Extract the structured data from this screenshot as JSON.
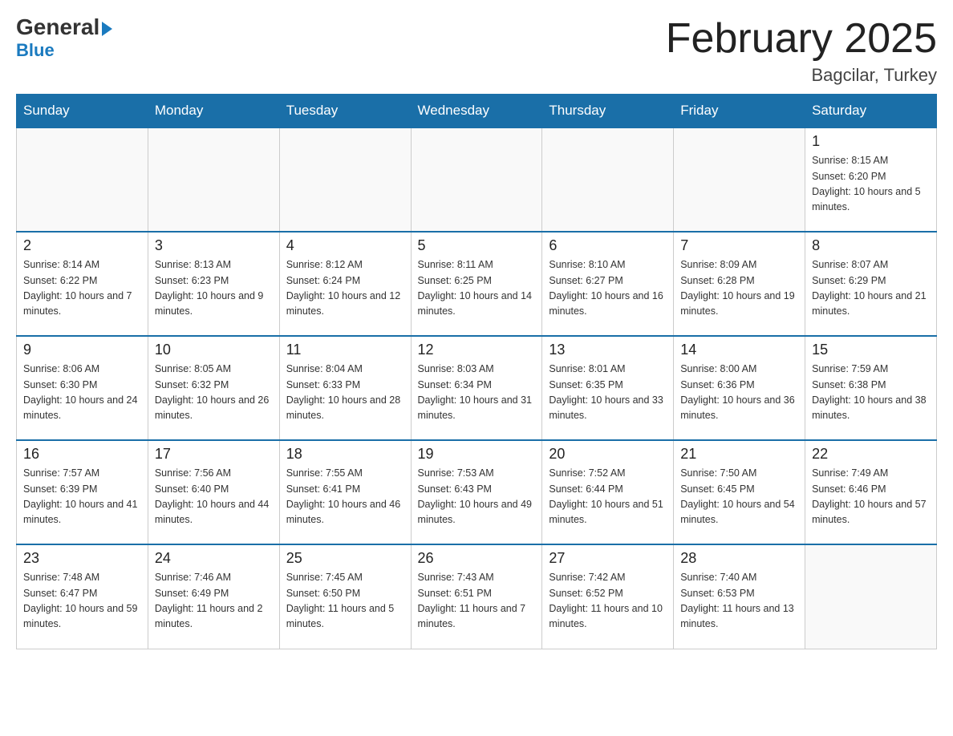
{
  "header": {
    "logo_general": "General",
    "logo_blue": "Blue",
    "month_title": "February 2025",
    "location": "Bagcilar, Turkey"
  },
  "days_of_week": [
    "Sunday",
    "Monday",
    "Tuesday",
    "Wednesday",
    "Thursday",
    "Friday",
    "Saturday"
  ],
  "weeks": [
    [
      {
        "day": "",
        "info": ""
      },
      {
        "day": "",
        "info": ""
      },
      {
        "day": "",
        "info": ""
      },
      {
        "day": "",
        "info": ""
      },
      {
        "day": "",
        "info": ""
      },
      {
        "day": "",
        "info": ""
      },
      {
        "day": "1",
        "info": "Sunrise: 8:15 AM\nSunset: 6:20 PM\nDaylight: 10 hours and 5 minutes."
      }
    ],
    [
      {
        "day": "2",
        "info": "Sunrise: 8:14 AM\nSunset: 6:22 PM\nDaylight: 10 hours and 7 minutes."
      },
      {
        "day": "3",
        "info": "Sunrise: 8:13 AM\nSunset: 6:23 PM\nDaylight: 10 hours and 9 minutes."
      },
      {
        "day": "4",
        "info": "Sunrise: 8:12 AM\nSunset: 6:24 PM\nDaylight: 10 hours and 12 minutes."
      },
      {
        "day": "5",
        "info": "Sunrise: 8:11 AM\nSunset: 6:25 PM\nDaylight: 10 hours and 14 minutes."
      },
      {
        "day": "6",
        "info": "Sunrise: 8:10 AM\nSunset: 6:27 PM\nDaylight: 10 hours and 16 minutes."
      },
      {
        "day": "7",
        "info": "Sunrise: 8:09 AM\nSunset: 6:28 PM\nDaylight: 10 hours and 19 minutes."
      },
      {
        "day": "8",
        "info": "Sunrise: 8:07 AM\nSunset: 6:29 PM\nDaylight: 10 hours and 21 minutes."
      }
    ],
    [
      {
        "day": "9",
        "info": "Sunrise: 8:06 AM\nSunset: 6:30 PM\nDaylight: 10 hours and 24 minutes."
      },
      {
        "day": "10",
        "info": "Sunrise: 8:05 AM\nSunset: 6:32 PM\nDaylight: 10 hours and 26 minutes."
      },
      {
        "day": "11",
        "info": "Sunrise: 8:04 AM\nSunset: 6:33 PM\nDaylight: 10 hours and 28 minutes."
      },
      {
        "day": "12",
        "info": "Sunrise: 8:03 AM\nSunset: 6:34 PM\nDaylight: 10 hours and 31 minutes."
      },
      {
        "day": "13",
        "info": "Sunrise: 8:01 AM\nSunset: 6:35 PM\nDaylight: 10 hours and 33 minutes."
      },
      {
        "day": "14",
        "info": "Sunrise: 8:00 AM\nSunset: 6:36 PM\nDaylight: 10 hours and 36 minutes."
      },
      {
        "day": "15",
        "info": "Sunrise: 7:59 AM\nSunset: 6:38 PM\nDaylight: 10 hours and 38 minutes."
      }
    ],
    [
      {
        "day": "16",
        "info": "Sunrise: 7:57 AM\nSunset: 6:39 PM\nDaylight: 10 hours and 41 minutes."
      },
      {
        "day": "17",
        "info": "Sunrise: 7:56 AM\nSunset: 6:40 PM\nDaylight: 10 hours and 44 minutes."
      },
      {
        "day": "18",
        "info": "Sunrise: 7:55 AM\nSunset: 6:41 PM\nDaylight: 10 hours and 46 minutes."
      },
      {
        "day": "19",
        "info": "Sunrise: 7:53 AM\nSunset: 6:43 PM\nDaylight: 10 hours and 49 minutes."
      },
      {
        "day": "20",
        "info": "Sunrise: 7:52 AM\nSunset: 6:44 PM\nDaylight: 10 hours and 51 minutes."
      },
      {
        "day": "21",
        "info": "Sunrise: 7:50 AM\nSunset: 6:45 PM\nDaylight: 10 hours and 54 minutes."
      },
      {
        "day": "22",
        "info": "Sunrise: 7:49 AM\nSunset: 6:46 PM\nDaylight: 10 hours and 57 minutes."
      }
    ],
    [
      {
        "day": "23",
        "info": "Sunrise: 7:48 AM\nSunset: 6:47 PM\nDaylight: 10 hours and 59 minutes."
      },
      {
        "day": "24",
        "info": "Sunrise: 7:46 AM\nSunset: 6:49 PM\nDaylight: 11 hours and 2 minutes."
      },
      {
        "day": "25",
        "info": "Sunrise: 7:45 AM\nSunset: 6:50 PM\nDaylight: 11 hours and 5 minutes."
      },
      {
        "day": "26",
        "info": "Sunrise: 7:43 AM\nSunset: 6:51 PM\nDaylight: 11 hours and 7 minutes."
      },
      {
        "day": "27",
        "info": "Sunrise: 7:42 AM\nSunset: 6:52 PM\nDaylight: 11 hours and 10 minutes."
      },
      {
        "day": "28",
        "info": "Sunrise: 7:40 AM\nSunset: 6:53 PM\nDaylight: 11 hours and 13 minutes."
      },
      {
        "day": "",
        "info": ""
      }
    ]
  ]
}
